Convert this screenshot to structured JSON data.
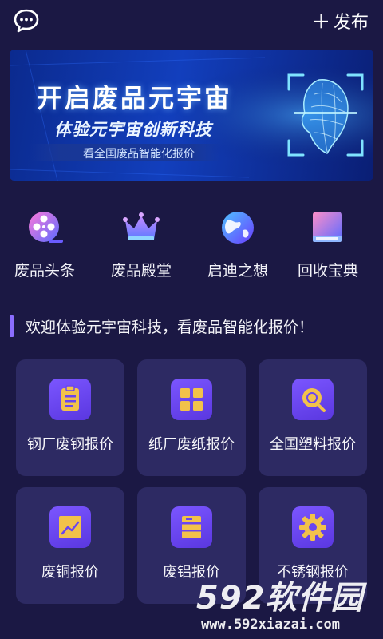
{
  "header": {
    "publish_label": "发布"
  },
  "banner": {
    "title": "开启废品元宇宙",
    "subtitle": "体验元宇宙创新科技",
    "tagline": "看全国废品智能化报价"
  },
  "quick_nav": [
    {
      "label": "废品头条",
      "icon": "film-reel-icon"
    },
    {
      "label": "废品殿堂",
      "icon": "crown-icon"
    },
    {
      "label": "启迪之想",
      "icon": "globe-icon"
    },
    {
      "label": "回收宝典",
      "icon": "book-icon"
    }
  ],
  "notice": {
    "text": "欢迎体验元宇宙科技，看废品智能化报价！"
  },
  "cards": [
    {
      "label": "钢厂废钢报价",
      "icon": "clipboard-icon"
    },
    {
      "label": "纸厂废纸报价",
      "icon": "grid-icon"
    },
    {
      "label": "全国塑料报价",
      "icon": "magnifier-icon"
    },
    {
      "label": "废铜报价",
      "icon": "chart-icon"
    },
    {
      "label": "废铝报价",
      "icon": "stack-icon"
    },
    {
      "label": "不锈钢报价",
      "icon": "gear-icon"
    }
  ],
  "watermark": {
    "logo": "592软件园",
    "url": "www.592xiazai.com"
  },
  "colors": {
    "background": "#1b1844",
    "card": "#2d2a63",
    "accent": "#6a45f0",
    "icon_glyph": "#f2c24a"
  }
}
